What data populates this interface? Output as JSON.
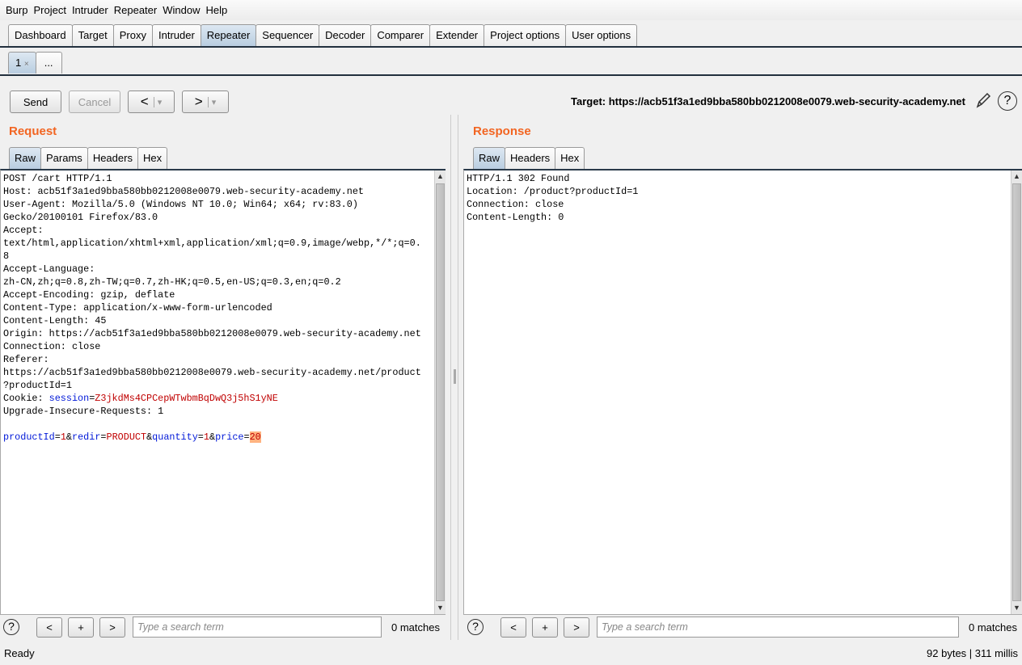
{
  "menu": [
    "Burp",
    "Project",
    "Intruder",
    "Repeater",
    "Window",
    "Help"
  ],
  "main_tabs": [
    "Dashboard",
    "Target",
    "Proxy",
    "Intruder",
    "Repeater",
    "Sequencer",
    "Decoder",
    "Comparer",
    "Extender",
    "Project options",
    "User options"
  ],
  "active_main_tab": "Repeater",
  "sub_tabs": {
    "tab1": "1",
    "close": "×",
    "more": "..."
  },
  "toolbar": {
    "send": "Send",
    "cancel": "Cancel",
    "back": "<",
    "forward": ">",
    "dropdown": "▾",
    "target": "Target: https://acb51f3a1ed9bba580bb0212008e0079.web-security-academy.net"
  },
  "request": {
    "title": "Request",
    "tabs": [
      "Raw",
      "Params",
      "Headers",
      "Hex"
    ],
    "lines": [
      "POST /cart HTTP/1.1",
      "Host: acb51f3a1ed9bba580bb0212008e0079.web-security-academy.net",
      "User-Agent: Mozilla/5.0 (Windows NT 10.0; Win64; x64; rv:83.0)",
      "Gecko/20100101 Firefox/83.0",
      "Accept:",
      "text/html,application/xhtml+xml,application/xml;q=0.9,image/webp,*/*;q=0.",
      "8",
      "Accept-Language:",
      "zh-CN,zh;q=0.8,zh-TW;q=0.7,zh-HK;q=0.5,en-US;q=0.3,en;q=0.2",
      "Accept-Encoding: gzip, deflate",
      "Content-Type: application/x-www-form-urlencoded",
      "Content-Length: 45",
      "Origin: https://acb51f3a1ed9bba580bb0212008e0079.web-security-academy.net",
      "Connection: close",
      "Referer:",
      "https://acb51f3a1ed9bba580bb0212008e0079.web-security-academy.net/product",
      "?productId=1"
    ],
    "cookie": {
      "prefix": "Cookie: ",
      "name": "session",
      "eq": "=",
      "value": "Z3jkdMs4CPCepWTwbmBqDwQ3j5hS1yNE"
    },
    "after_cookie": "Upgrade-Insecure-Requests: 1",
    "body": {
      "k1": "productId",
      "v1": "1",
      "k2": "redir",
      "v2": "PRODUCT",
      "k3": "quantity",
      "v3": "1",
      "k4": "price",
      "v4": "20"
    },
    "search_placeholder": "Type a search term",
    "matches": "0 matches"
  },
  "response": {
    "title": "Response",
    "tabs": [
      "Raw",
      "Headers",
      "Hex"
    ],
    "lines": [
      "HTTP/1.1 302 Found",
      "Location: /product?productId=1",
      "Connection: close",
      "Content-Length: 0"
    ],
    "search_placeholder": "Type a search term",
    "matches": "0 matches"
  },
  "search_buttons": {
    "prev": "<",
    "add": "+",
    "next": ">",
    "help": "?"
  },
  "status": {
    "left": "Ready",
    "right": "92 bytes | 311 millis"
  }
}
